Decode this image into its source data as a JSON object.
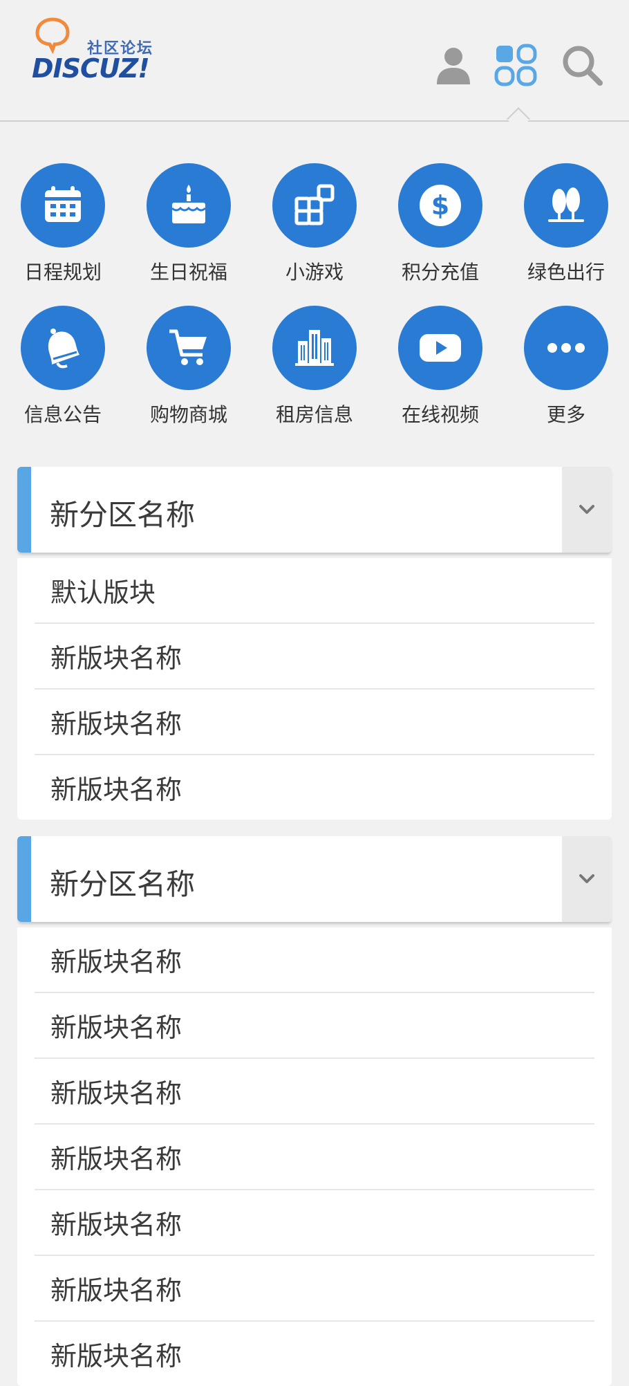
{
  "header": {
    "logo_cn": "社区论坛",
    "logo_en": "DISCUZ!",
    "icons": [
      "user-icon",
      "grid-menu-icon",
      "search-icon"
    ],
    "accent_color": "#2a7bd4"
  },
  "nav_grid": [
    {
      "label": "日程规划",
      "icon": "calendar-icon"
    },
    {
      "label": "生日祝福",
      "icon": "cake-icon"
    },
    {
      "label": "小游戏",
      "icon": "game-blocks-icon"
    },
    {
      "label": "积分充值",
      "icon": "dollar-icon"
    },
    {
      "label": "绿色出行",
      "icon": "trees-icon"
    },
    {
      "label": "信息公告",
      "icon": "bell-icon"
    },
    {
      "label": "购物商城",
      "icon": "cart-icon"
    },
    {
      "label": "租房信息",
      "icon": "buildings-icon"
    },
    {
      "label": "在线视频",
      "icon": "video-play-icon"
    },
    {
      "label": "更多",
      "icon": "more-dots-icon"
    }
  ],
  "sections": [
    {
      "title": "新分区名称",
      "forums": [
        "默认版块",
        "新版块名称",
        "新版块名称",
        "新版块名称"
      ]
    },
    {
      "title": "新分区名称",
      "forums": [
        "新版块名称",
        "新版块名称",
        "新版块名称",
        "新版块名称",
        "新版块名称",
        "新版块名称",
        "新版块名称"
      ]
    }
  ]
}
